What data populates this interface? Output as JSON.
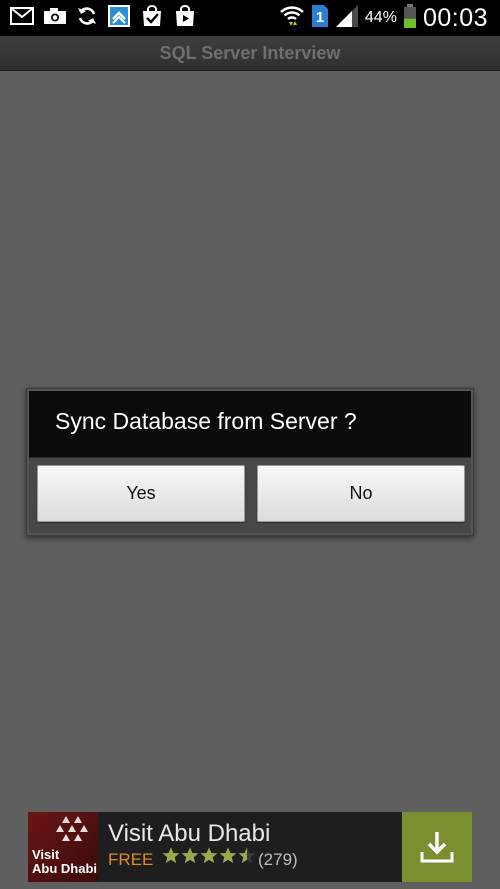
{
  "status_bar": {
    "icons_left": [
      "mail-icon",
      "camera-icon",
      "sync-icon",
      "app-icon",
      "bag-check-icon",
      "bag-play-icon"
    ],
    "icons_right": [
      "wifi-icon",
      "sim-icon",
      "signal-icon",
      "battery-icon"
    ],
    "sim_number": "1",
    "battery_percent": "44%",
    "battery_level": 0.44,
    "time": "00:03"
  },
  "app": {
    "title": "SQL Server Interview"
  },
  "dialog": {
    "message": "Sync Database from Server ?",
    "yes_label": "Yes",
    "no_label": "No"
  },
  "ad": {
    "logo_text": "Visit\nAbu Dhabi",
    "title": "Visit Abu Dhabi",
    "price": "FREE",
    "rating": 4.5,
    "rating_count": "(279)",
    "colors": {
      "price": "#e08a22",
      "download_bg": "#7a8f2f",
      "star": "#9aaa4a"
    }
  }
}
